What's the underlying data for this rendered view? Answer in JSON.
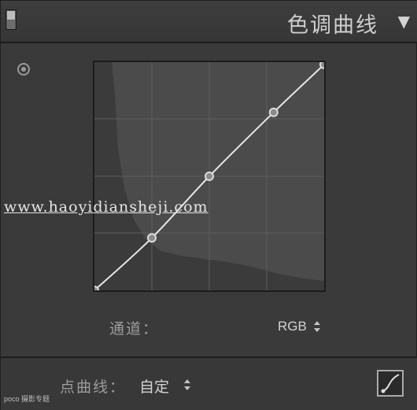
{
  "header": {
    "title": "色调曲线",
    "collapse_glyph": "▼"
  },
  "watermark": "www.haoyidiansheji.com",
  "curve": {
    "points": [
      [
        0,
        0
      ],
      [
        0.25,
        0.23
      ],
      [
        0.5,
        0.5
      ],
      [
        0.78,
        0.78
      ],
      [
        1,
        0.99
      ]
    ]
  },
  "channel": {
    "label": "通道：",
    "value": "RGB"
  },
  "point_curve": {
    "label": "点曲线：",
    "value": "自定"
  },
  "footer_logo": "poco 摄影专题"
}
